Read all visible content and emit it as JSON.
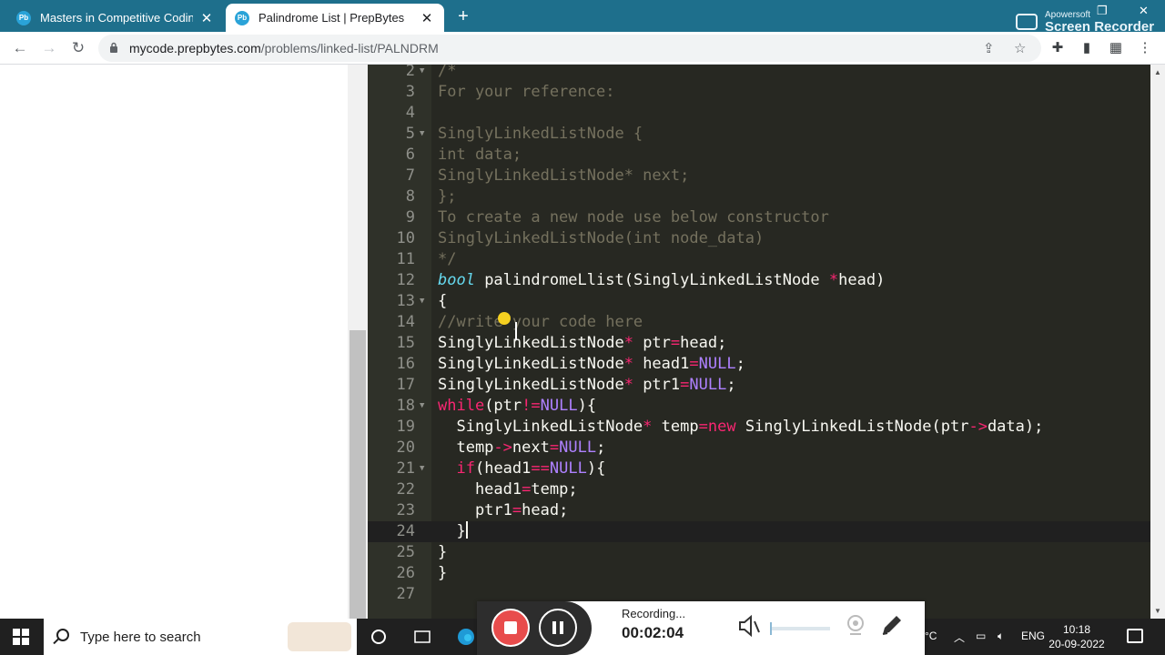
{
  "browser": {
    "tabs": [
      {
        "title": "Masters in Competitive Coding |",
        "favicon": "Pb",
        "active": false
      },
      {
        "title": "Palindrome List | PrepBytes",
        "favicon": "Pb",
        "active": true
      }
    ],
    "url_host": "mycode.prepbytes.com",
    "url_path": "/problems/linked-list/PALNDRM",
    "accent_color": "#1e6f8c"
  },
  "watermark": {
    "line1": "Apowersoft",
    "line2": "Screen Recorder"
  },
  "editor": {
    "lines": [
      {
        "n": "2",
        "fold": true,
        "parts": [
          [
            "cm",
            "/*"
          ]
        ]
      },
      {
        "n": "3",
        "parts": [
          [
            "cm",
            "For your reference:"
          ]
        ]
      },
      {
        "n": "4",
        "parts": []
      },
      {
        "n": "5",
        "fold": true,
        "parts": [
          [
            "cm",
            "SinglyLinkedListNode {"
          ]
        ]
      },
      {
        "n": "6",
        "parts": [
          [
            "cm",
            "int data;"
          ]
        ]
      },
      {
        "n": "7",
        "parts": [
          [
            "cm",
            "SinglyLinkedListNode* next;"
          ]
        ]
      },
      {
        "n": "8",
        "parts": [
          [
            "cm",
            "};"
          ]
        ]
      },
      {
        "n": "9",
        "parts": [
          [
            "cm",
            "To create a new node use below constructor"
          ]
        ]
      },
      {
        "n": "10",
        "parts": [
          [
            "cm",
            "SinglyLinkedListNode(int node_data)"
          ]
        ]
      },
      {
        "n": "11",
        "parts": [
          [
            "cm",
            "*/"
          ]
        ]
      },
      {
        "n": "12",
        "parts": [
          [
            "ty",
            "bool"
          ],
          [
            "",
            " palindromeLlist(SinglyLinkedListNode "
          ],
          [
            "kw",
            "*"
          ],
          [
            "",
            "head)"
          ]
        ]
      },
      {
        "n": "13",
        "fold": true,
        "parts": [
          [
            "",
            "{"
          ]
        ]
      },
      {
        "n": "14",
        "parts": [
          [
            "cm",
            "//write your code here"
          ]
        ]
      },
      {
        "n": "15",
        "parts": [
          [
            "",
            "SinglyLinkedListNode"
          ],
          [
            "kw",
            "*"
          ],
          [
            "",
            " ptr"
          ],
          [
            "kw",
            "="
          ],
          [
            "",
            "head;"
          ]
        ]
      },
      {
        "n": "16",
        "parts": [
          [
            "",
            "SinglyLinkedListNode"
          ],
          [
            "kw",
            "*"
          ],
          [
            "",
            " head1"
          ],
          [
            "kw",
            "="
          ],
          [
            "cn",
            "NULL"
          ],
          [
            "",
            ";"
          ]
        ]
      },
      {
        "n": "17",
        "parts": [
          [
            "",
            "SinglyLinkedListNode"
          ],
          [
            "kw",
            "*"
          ],
          [
            "",
            " ptr1"
          ],
          [
            "kw",
            "="
          ],
          [
            "cn",
            "NULL"
          ],
          [
            "",
            ";"
          ]
        ]
      },
      {
        "n": "18",
        "fold": true,
        "parts": [
          [
            "kw",
            "while"
          ],
          [
            "",
            "(ptr"
          ],
          [
            "kw",
            "!="
          ],
          [
            "cn",
            "NULL"
          ],
          [
            "",
            "){"
          ]
        ]
      },
      {
        "n": "19",
        "parts": [
          [
            "",
            "  SinglyLinkedListNode"
          ],
          [
            "kw",
            "*"
          ],
          [
            "",
            " temp"
          ],
          [
            "kw",
            "="
          ],
          [
            "kw",
            "new"
          ],
          [
            "",
            " SinglyLinkedListNode(ptr"
          ],
          [
            "kw",
            "->"
          ],
          [
            "",
            "data);"
          ]
        ]
      },
      {
        "n": "20",
        "parts": [
          [
            "",
            "  temp"
          ],
          [
            "kw",
            "->"
          ],
          [
            "",
            "next"
          ],
          [
            "kw",
            "="
          ],
          [
            "cn",
            "NULL"
          ],
          [
            "",
            ";"
          ]
        ]
      },
      {
        "n": "21",
        "fold": true,
        "parts": [
          [
            "",
            "  "
          ],
          [
            "kw",
            "if"
          ],
          [
            "",
            "(head1"
          ],
          [
            "kw",
            "=="
          ],
          [
            "cn",
            "NULL"
          ],
          [
            "",
            "){"
          ]
        ]
      },
      {
        "n": "22",
        "parts": [
          [
            "",
            "    head1"
          ],
          [
            "kw",
            "="
          ],
          [
            "",
            "temp;"
          ]
        ]
      },
      {
        "n": "23",
        "parts": [
          [
            "",
            "    ptr1"
          ],
          [
            "kw",
            "="
          ],
          [
            "",
            "head;"
          ]
        ]
      },
      {
        "n": "24",
        "active": true,
        "cursor": true,
        "parts": [
          [
            "",
            "  }"
          ]
        ]
      },
      {
        "n": "25",
        "parts": [
          [
            "",
            "}"
          ]
        ]
      },
      {
        "n": "26",
        "parts": [
          [
            "",
            "}"
          ]
        ]
      },
      {
        "n": "27",
        "parts": []
      }
    ]
  },
  "taskbar": {
    "search_placeholder": "Type here to search",
    "temp_unit": "°C",
    "language": "ENG",
    "time": "10:18",
    "date": "20-09-2022"
  },
  "recorder": {
    "status": "Recording...",
    "elapsed": "00:02:04",
    "stop_color": "#e84c4c"
  }
}
